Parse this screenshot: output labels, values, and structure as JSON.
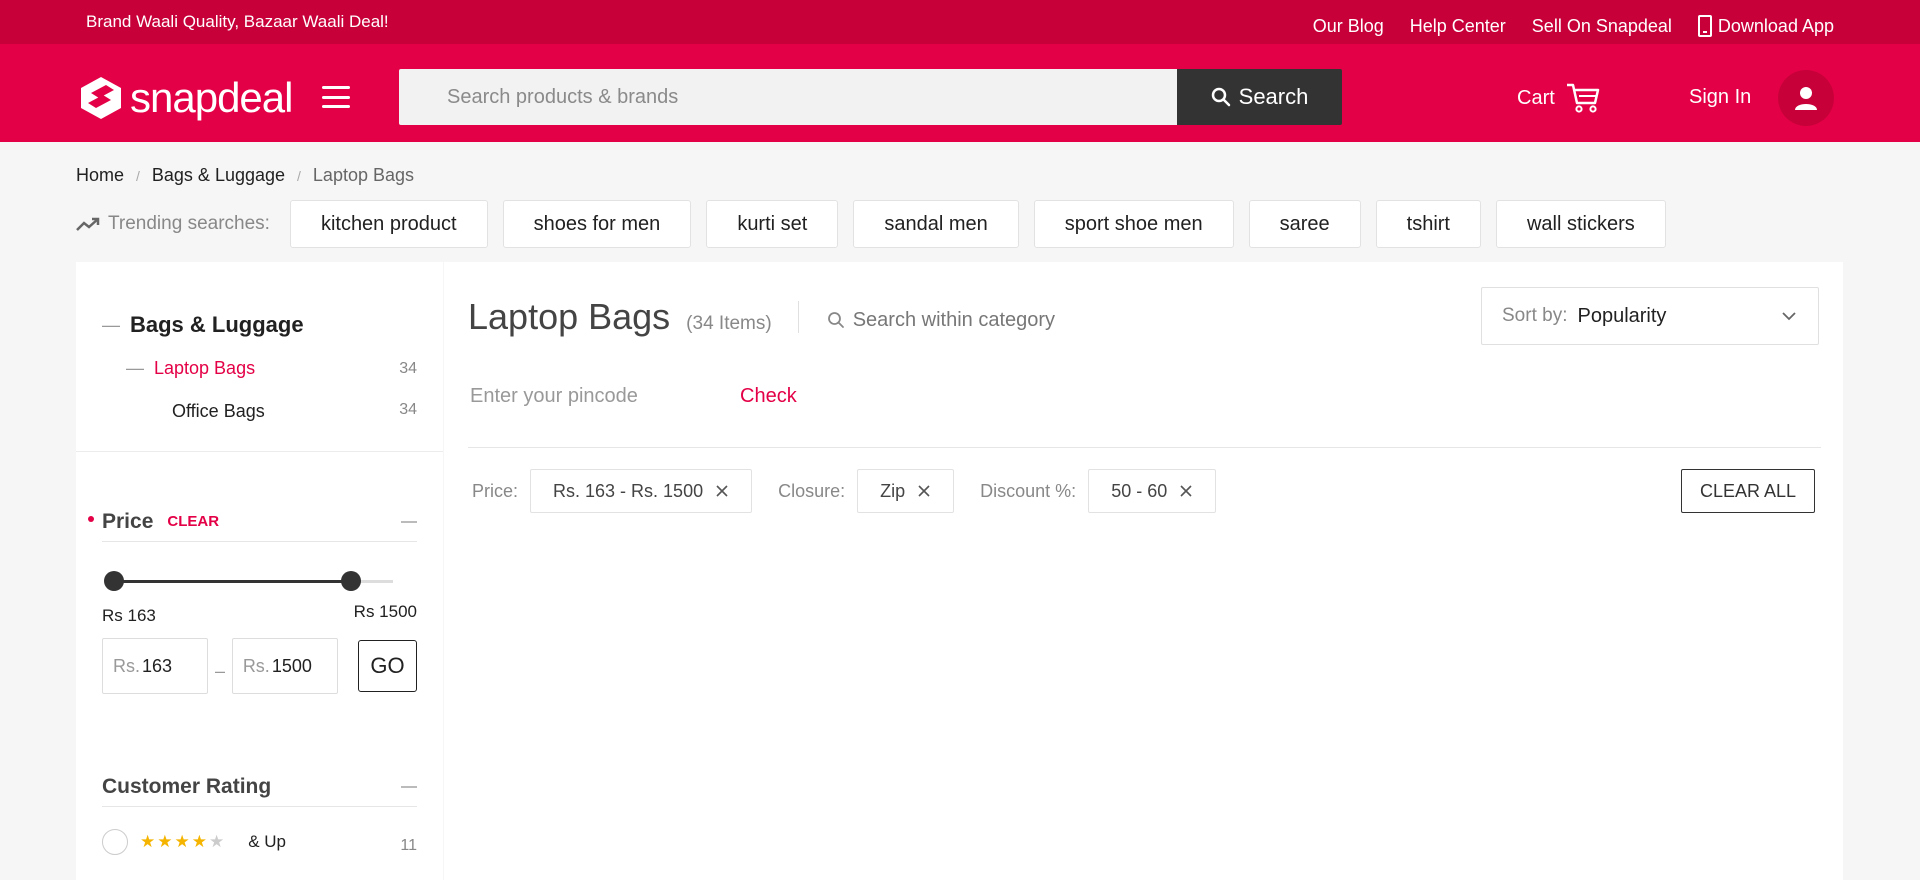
{
  "topbar": {
    "tagline": "Brand Waali Quality, Bazaar Waali Deal!",
    "links": [
      "Our Blog",
      "Help Center",
      "Sell On Snapdeal"
    ],
    "download_label": "Download App"
  },
  "header": {
    "logo_text": "snapdeal",
    "search_placeholder": "Search products & brands",
    "search_button": "Search",
    "cart_label": "Cart",
    "signin_label": "Sign In"
  },
  "breadcrumb": {
    "home": "Home",
    "category": "Bags & Luggage",
    "current": "Laptop Bags"
  },
  "trending": {
    "label": "Trending searches:",
    "chips": [
      "kitchen product",
      "shoes for men",
      "kurti set",
      "sandal men",
      "sport shoe men",
      "saree",
      "tshirt",
      "wall stickers"
    ]
  },
  "sidebar": {
    "category": {
      "title": "Bags & Luggage",
      "sub": "Laptop Bags",
      "sub_count": "34",
      "subsub": "Office Bags",
      "subsub_count": "34"
    },
    "price": {
      "title": "Price",
      "clear": "CLEAR",
      "min_label": "Rs 163",
      "max_label": "Rs 1500",
      "rs_prefix": "Rs.",
      "min_value": "163",
      "max_value": "1500",
      "go": "GO",
      "slider_min_fraction": 0.0,
      "slider_max_fraction": 0.85
    },
    "rating": {
      "title": "Customer Rating",
      "stars_on": "★★★★",
      "stars_off": "★",
      "and_up": "& Up",
      "count": "11"
    }
  },
  "main": {
    "title": "Laptop Bags",
    "items": "(34 Items)",
    "search_within": "Search within category",
    "sort_label": "Sort by:",
    "sort_value": "Popularity",
    "pincode_placeholder": "Enter your pincode",
    "check": "Check",
    "filters": [
      {
        "label": "Price:",
        "value": "Rs. 163 - Rs. 1500"
      },
      {
        "label": "Closure:",
        "value": "Zip"
      },
      {
        "label": "Discount %:",
        "value": "50 - 60"
      }
    ],
    "clear_all": "CLEAR ALL"
  },
  "colors": {
    "brand": "#e40046",
    "brand_dark": "#c8003a",
    "button_dark": "#333333",
    "star": "#f4b400"
  }
}
